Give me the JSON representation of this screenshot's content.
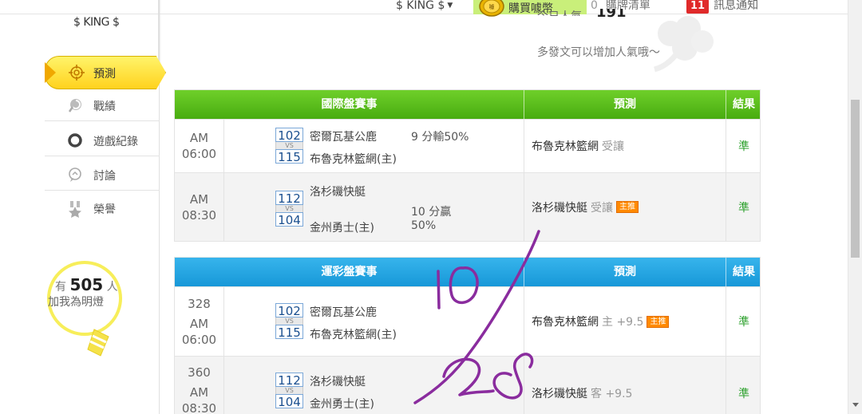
{
  "topbar": {
    "user": "$ KING $",
    "buy_coins": "購買噱幣",
    "cart_count": "0",
    "cart_label": "購牌清單",
    "msg_count": "11",
    "msg_label": "訊息通知"
  },
  "sidebar": {
    "username": "$ KING $",
    "items": [
      {
        "label": "預測",
        "icon": "target-icon"
      },
      {
        "label": "戰績",
        "icon": "swirl-icon"
      },
      {
        "label": "遊戲紀錄",
        "icon": "ring-icon"
      },
      {
        "label": "討論",
        "icon": "chat-icon"
      },
      {
        "label": "榮譽",
        "icon": "medal-icon"
      }
    ],
    "bulb_prefix": "有",
    "bulb_count": "505",
    "bulb_suffix": "人",
    "bulb_text": "加我為明燈"
  },
  "popularity": {
    "label": "今日人氣",
    "value": "191",
    "hint": "多發文可以增加人氣哦～"
  },
  "intl_table": {
    "header": {
      "match": "國際盤賽事",
      "prediction": "預測",
      "result": "結果"
    },
    "rows": [
      {
        "time1": "AM",
        "time2": "06:00",
        "score_top": "102",
        "score_bottom": "115",
        "team_top": "密爾瓦基公鹿",
        "team_bottom": "布魯克林籃網(主)",
        "odds_line1": "9 分輸50%",
        "pred_team": "布魯克林籃網",
        "pred_sub": "受讓",
        "result": "準"
      },
      {
        "time1": "AM",
        "time2": "08:30",
        "score_top": "112",
        "score_bottom": "104",
        "team_top": "洛杉磯快艇",
        "team_bottom": "金州勇士(主)",
        "odds_line1": "10 分贏",
        "odds_line2": "50%",
        "pred_team": "洛杉磯快艇",
        "pred_sub": "受讓",
        "pred_tag": "主推",
        "result": "準"
      }
    ]
  },
  "sport_table": {
    "header": {
      "match": "運彩盤賽事",
      "prediction": "預測",
      "result": "結果"
    },
    "rows": [
      {
        "code": "328",
        "time1": "AM",
        "time2": "06:00",
        "score_top": "102",
        "score_bottom": "115",
        "team_top": "密爾瓦基公鹿",
        "team_bottom": "布魯克林籃網(主)",
        "pred_team": "布魯克林籃網",
        "pred_sub": "主 +9.5",
        "pred_tag": "主推",
        "result": "準"
      },
      {
        "code": "360",
        "time1": "AM",
        "time2": "08:30",
        "score_top": "112",
        "score_bottom": "104",
        "team_top": "洛杉磯快艇",
        "team_bottom": "金州勇士(主)",
        "pred_team": "洛杉磯快艇",
        "pred_sub": "客 +9.5",
        "result": "準"
      }
    ]
  },
  "vs_label": "VS",
  "handwriting": "10/28",
  "colors": {
    "green_header": "#48ac10",
    "blue_header": "#1798d8",
    "active_nav": "#ffd21e",
    "ink": "#8a2c9e"
  }
}
